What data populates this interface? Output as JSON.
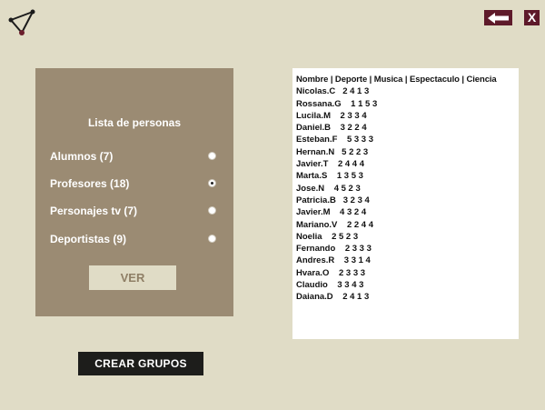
{
  "app": {
    "logo_icon": "triangle-nodes-icon",
    "back_icon": "arrow-left-icon",
    "close_label": "X"
  },
  "panel": {
    "title": "Lista de personas",
    "options": [
      {
        "label": "Alumnos (7)",
        "selected": false
      },
      {
        "label": "Profesores (18)",
        "selected": true
      },
      {
        "label": "Personajes tv (7)",
        "selected": false
      },
      {
        "label": "Deportistas (9)",
        "selected": false
      }
    ],
    "ver_label": "VER"
  },
  "crear_label": "CREAR GRUPOS",
  "list": {
    "header": "Nombre | Deporte | Musica | Espectaculo | Ciencia",
    "rows": [
      "Nicolas.C   2 4 1 3",
      "Rossana.G    1 1 5 3",
      "Lucila.M    2 3 3 4",
      "Daniel.B    3 2 2 4",
      "Esteban.F    5 3 3 3",
      "Hernan.N   5 2 2 3",
      "Javier.T    2 4 4 4",
      "Marta.S    1 3 5 3",
      "Jose.N    4 5 2 3",
      "Patricia.B   3 2 3 4",
      "Javier.M    4 3 2 4",
      "Mariano.V    2 2 4 4",
      "Noelia    2 5 2 3",
      "Fernando    2 3 3 3",
      "Andres.R    3 3 1 4",
      "Hvara.O    2 3 3 3",
      "Claudio    3 3 4 3",
      "Daiana.D    2 4 1 3"
    ]
  },
  "colors": {
    "background": "#e0dcc6",
    "panel": "#9b8b73",
    "accent": "#5e1a2a",
    "dark_button": "#1d1d1b"
  }
}
